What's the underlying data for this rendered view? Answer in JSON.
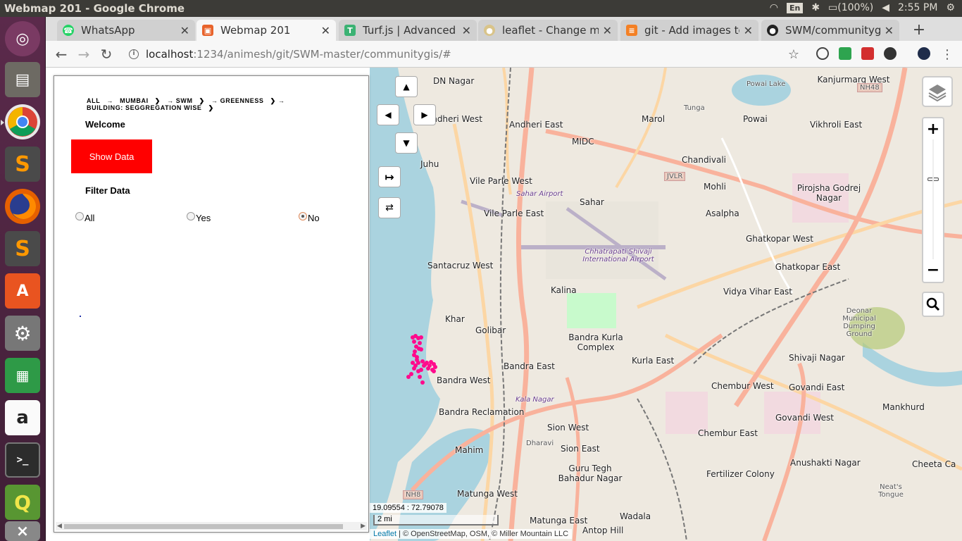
{
  "os": {
    "window_title": "Webmap 201 - Google Chrome",
    "keyboard_layout": "En",
    "battery": "(100%)",
    "clock": "2:55 PM"
  },
  "launcher": {
    "items": [
      "ubuntu-dash",
      "files",
      "chrome",
      "sublime-text",
      "firefox",
      "sublime-text-2",
      "software-center",
      "system-settings",
      "libreoffice-calc",
      "amazon",
      "terminal",
      "qgis",
      "trash"
    ]
  },
  "browser": {
    "tabs": [
      {
        "label": "WhatsApp",
        "icon": "whatsapp-icon",
        "color": "#25d366",
        "active": false
      },
      {
        "label": "Webmap 201",
        "icon": "parcel-icon",
        "color": "#e8632b",
        "active": true
      },
      {
        "label": "Turf.js | Advanced g",
        "icon": "turf-icon",
        "color": "#3bb273",
        "active": false
      },
      {
        "label": "leaflet - Change mar",
        "icon": "stackoverflow-icon",
        "color": "#f48024",
        "active": false
      },
      {
        "label": "git - Add images to R",
        "icon": "stackoverflow-icon",
        "color": "#f48024",
        "active": false
      },
      {
        "label": "SWM/communitygis",
        "icon": "github-icon",
        "color": "#222222",
        "active": false
      }
    ],
    "url_host": "localhost",
    "url_path": ":1234/animesh/git/SWM-master/communitygis/#"
  },
  "panel": {
    "breadcrumb": [
      "ALL",
      "MUMBAI",
      "SWM",
      "GREENNESS",
      "BUILDING: SEGGREGATION WISE"
    ],
    "welcome": "Welcome",
    "show_data_label": "Show Data",
    "filter_label": "Filter Data",
    "filter_options": [
      {
        "label": "All",
        "checked": false
      },
      {
        "label": "Yes",
        "checked": false
      },
      {
        "label": "No",
        "checked": true
      }
    ]
  },
  "map": {
    "coords": "19.09554 : 72.79078",
    "scale": "2 mi",
    "attribution_leaflet": "Leaflet",
    "attribution_rest": " | © OpenStreetMap, OSM, © Miller Mountain LLC",
    "labels": [
      {
        "text": "DN Nagar",
        "cls": ""
      },
      {
        "text": "Andheri West",
        "cls": ""
      },
      {
        "text": "Andheri East",
        "cls": ""
      },
      {
        "text": "MIDC",
        "cls": ""
      },
      {
        "text": "Marol",
        "cls": ""
      },
      {
        "text": "Tunga",
        "cls": "small"
      },
      {
        "text": "Powai",
        "cls": ""
      },
      {
        "text": "Powai Lake",
        "cls": "small"
      },
      {
        "text": "Kanjurmarg West",
        "cls": ""
      },
      {
        "text": "Vikhroli East",
        "cls": ""
      },
      {
        "text": "Juhu",
        "cls": ""
      },
      {
        "text": "Vile Parle West",
        "cls": ""
      },
      {
        "text": "Vile Parle East",
        "cls": ""
      },
      {
        "text": "Sahar Airport",
        "cls": "italic"
      },
      {
        "text": "Sahar",
        "cls": ""
      },
      {
        "text": "Chandivali",
        "cls": ""
      },
      {
        "text": "Mohli",
        "cls": ""
      },
      {
        "text": "Asalpha",
        "cls": ""
      },
      {
        "text": "Pirojsha Godrej Nagar",
        "cls": ""
      },
      {
        "text": "Santacruz West",
        "cls": ""
      },
      {
        "text": "Chhatrapati Shivaji International Airport",
        "cls": "italic"
      },
      {
        "text": "Kalina",
        "cls": ""
      },
      {
        "text": "Ghatkopar West",
        "cls": ""
      },
      {
        "text": "Ghatkopar East",
        "cls": ""
      },
      {
        "text": "Vidya Vihar East",
        "cls": ""
      },
      {
        "text": "Khar",
        "cls": ""
      },
      {
        "text": "Golibar",
        "cls": ""
      },
      {
        "text": "Bandra Kurla Complex",
        "cls": ""
      },
      {
        "text": "Deonar Municipal Dumping Ground",
        "cls": "small"
      },
      {
        "text": "Bandra East",
        "cls": ""
      },
      {
        "text": "Kurla East",
        "cls": ""
      },
      {
        "text": "Shivaji Nagar",
        "cls": ""
      },
      {
        "text": "Bandra West",
        "cls": ""
      },
      {
        "text": "Chembur West",
        "cls": ""
      },
      {
        "text": "Govandi East",
        "cls": ""
      },
      {
        "text": "Kala Nagar",
        "cls": "italic"
      },
      {
        "text": "Bandra Reclamation",
        "cls": ""
      },
      {
        "text": "Mankhurd",
        "cls": ""
      },
      {
        "text": "Govandi West",
        "cls": ""
      },
      {
        "text": "Sion West",
        "cls": ""
      },
      {
        "text": "Chembur East",
        "cls": ""
      },
      {
        "text": "Mahim",
        "cls": ""
      },
      {
        "text": "Dharavi",
        "cls": "small"
      },
      {
        "text": "Sion East",
        "cls": ""
      },
      {
        "text": "Guru Tegh Bahadur Nagar",
        "cls": ""
      },
      {
        "text": "Anushakti Nagar",
        "cls": ""
      },
      {
        "text": "Cheeta Ca",
        "cls": ""
      },
      {
        "text": "Fertilizer Colony",
        "cls": ""
      },
      {
        "text": "Neat's Tongue",
        "cls": "small"
      },
      {
        "text": "Matunga West",
        "cls": ""
      },
      {
        "text": "Matunga East",
        "cls": ""
      },
      {
        "text": "Wadala",
        "cls": ""
      },
      {
        "text": "Antop Hill",
        "cls": ""
      },
      {
        "text": "JVLR",
        "cls": "small"
      },
      {
        "text": "NH8",
        "cls": "small"
      },
      {
        "text": "NH48",
        "cls": "small"
      }
    ]
  }
}
